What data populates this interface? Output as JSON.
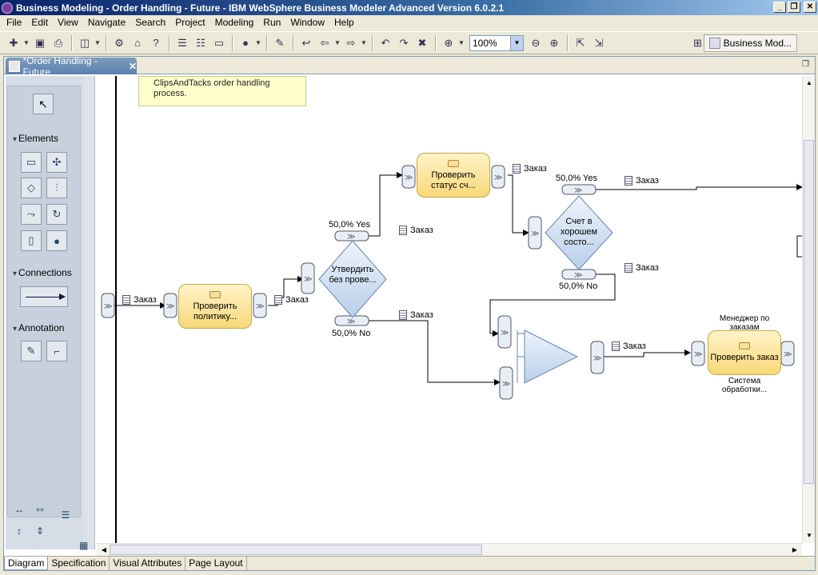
{
  "window": {
    "title": "Business Modeling - Order Handling - Future - IBM WebSphere Business Modeler Advanced Version 6.0.2.1",
    "minimize": "_",
    "restore": "❐",
    "close": "✕"
  },
  "menu": [
    "File",
    "Edit",
    "View",
    "Navigate",
    "Search",
    "Project",
    "Modeling",
    "Run",
    "Window",
    "Help"
  ],
  "toolbar": {
    "zoom_value": "100%",
    "perspective_label": "Business Mod..."
  },
  "editor": {
    "tab_label": "*Order Handling - Future",
    "tab_close": "✕"
  },
  "palette": {
    "sections": [
      "Elements",
      "Connections",
      "Annotation"
    ]
  },
  "diagram": {
    "note_text": "ClipsAndTacks order handling process.",
    "tasks": [
      "Проверить политику...",
      "Проверить статус сч...",
      "Проверить заказ"
    ],
    "gateways": [
      "Утвердить без прове...",
      "Счет в хорошем состо..."
    ],
    "branch_yes": "50,0% Yes",
    "branch_no": "50,0% No",
    "data_label": "Заказ",
    "role_label": "Менеджер по заказам",
    "resource_label": "Система обработки..."
  },
  "bottom_tabs": [
    "Diagram",
    "Specification",
    "Visual Attributes",
    "Page Layout"
  ],
  "colors": {
    "task_fill": "#f8d878",
    "gateway_fill": "#c8daf0",
    "note_fill": "#ffffcc",
    "title_bar": "#0a246a"
  }
}
